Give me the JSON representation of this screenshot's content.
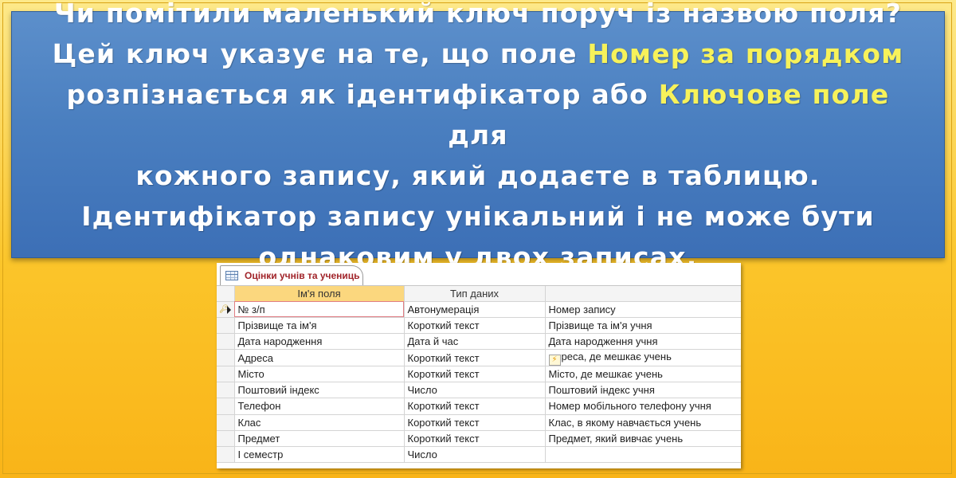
{
  "banner": {
    "line1": "Чи помітили маленький ключ поруч із назвою поля?",
    "line2_a": "Цей ключ указує на те, що поле ",
    "line2_highlight": "Номер за порядком",
    "line3_a": "розпізнається як ідентифікатор або ",
    "line3_highlight": "Ключове поле",
    "line3_b": " для",
    "line4": "кожного запису, який додаєте в таблицю.",
    "line5": "Ідентифікатор запису унікальний і не може бути",
    "line6": "однаковим у двох записах."
  },
  "window": {
    "tab_label": "Оцінки учнів та учениць",
    "tab_icon": "table-icon",
    "columns": [
      "Ім'я поля",
      "Тип даних",
      ""
    ],
    "rows": [
      {
        "name": "№ з/п",
        "type": "Автонумерація",
        "desc": "Номер запису"
      },
      {
        "name": "Прізвище та ім'я",
        "type": "Короткий текст",
        "desc": "Прізвище та ім'я учня"
      },
      {
        "name": "Дата народження",
        "type": "Дата й час",
        "desc": "Дата народження учня"
      },
      {
        "name": "Адреса",
        "type": "Короткий текст",
        "desc": "реса, де мешкає учень"
      },
      {
        "name": "Місто",
        "type": "Короткий текст",
        "desc": "Місто, де мешкає учень"
      },
      {
        "name": "Поштовий індекс",
        "type": "Число",
        "desc": "Поштовий індекс учня"
      },
      {
        "name": "Телефон",
        "type": "Короткий текст",
        "desc": "Номер мобільного телефону учня"
      },
      {
        "name": "Клас",
        "type": "Короткий текст",
        "desc": "Клас, в якому навчається учень"
      },
      {
        "name": "Предмет",
        "type": "Короткий текст",
        "desc": "Предмет, який вивчає учень"
      },
      {
        "name": "І семестр",
        "type": "Число",
        "desc": ""
      }
    ]
  },
  "colors": {
    "banner_bg": "#4a7fc0",
    "highlight_text": "#f7f25a",
    "page_bg": "#fbc52a",
    "tab_text": "#a1242a",
    "active_header": "#fbd77e"
  }
}
